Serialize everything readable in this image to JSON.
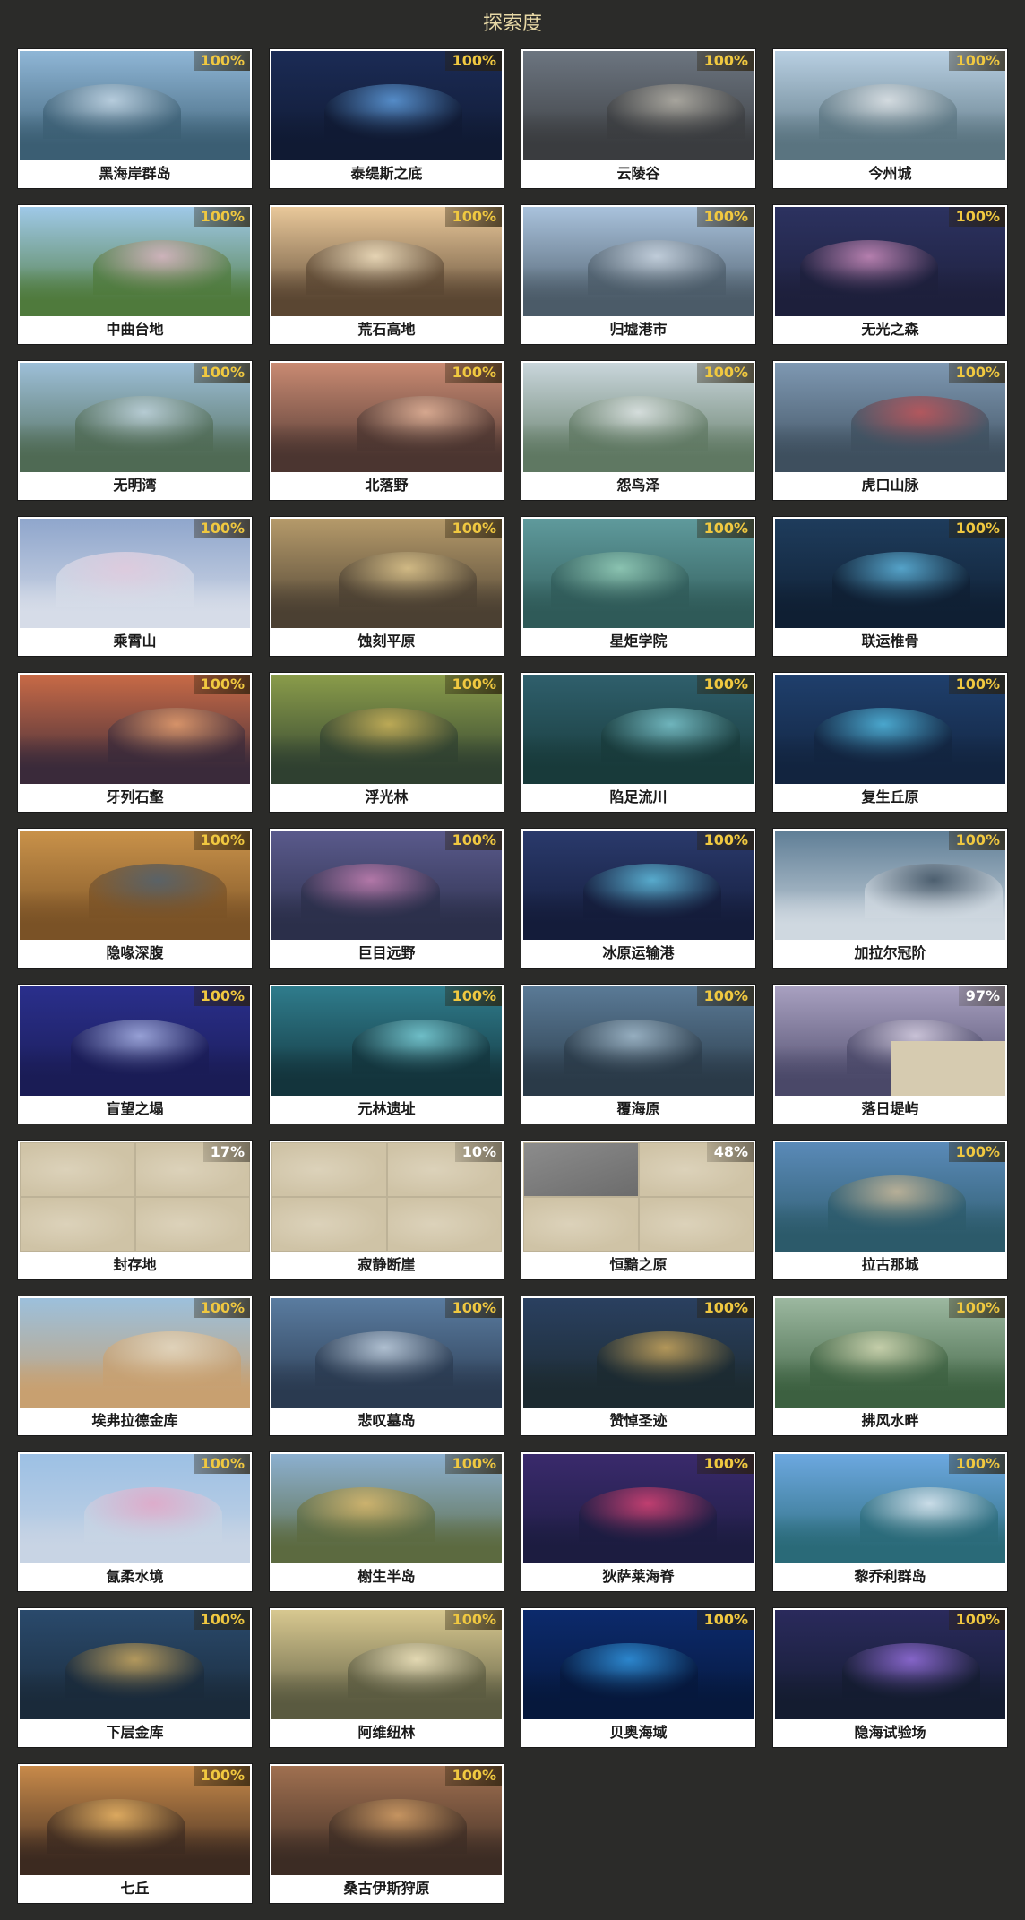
{
  "title": "探索度",
  "regions": [
    {
      "name": "黑海岸群岛",
      "progress": "100%",
      "sky": "#8fb6d6",
      "ground": "#3b5e73",
      "accent": "#d7e6f2"
    },
    {
      "name": "泰缇斯之底",
      "progress": "100%",
      "sky": "#1b2b55",
      "ground": "#101a33",
      "accent": "#6fb8ff"
    },
    {
      "name": "云陵谷",
      "progress": "100%",
      "sky": "#6c7580",
      "ground": "#3a3c3f",
      "accent": "#c9c3b5"
    },
    {
      "name": "今州城",
      "progress": "100%",
      "sky": "#b8cfe2",
      "ground": "#5a7480",
      "accent": "#f1f1f1"
    },
    {
      "name": "中曲台地",
      "progress": "100%",
      "sky": "#9fc9e8",
      "ground": "#4f7a3c",
      "accent": "#f0b8c8"
    },
    {
      "name": "荒石高地",
      "progress": "100%",
      "sky": "#e9c89a",
      "ground": "#5a4632",
      "accent": "#fff1d2"
    },
    {
      "name": "归墟港市",
      "progress": "100%",
      "sky": "#a9c2dc",
      "ground": "#4b5b68",
      "accent": "#dbe4ee"
    },
    {
      "name": "无光之森",
      "progress": "100%",
      "sky": "#2c3260",
      "ground": "#1d1f3b",
      "accent": "#f2a3d6"
    },
    {
      "name": "无明湾",
      "progress": "100%",
      "sky": "#9dbfd8",
      "ground": "#4f6a54",
      "accent": "#cfe0ea"
    },
    {
      "name": "北落野",
      "progress": "100%",
      "sky": "#c98a72",
      "ground": "#4b3530",
      "accent": "#f3c4a8"
    },
    {
      "name": "怨鸟泽",
      "progress": "100%",
      "sky": "#c9d6dc",
      "ground": "#5f7862",
      "accent": "#eef2f3"
    },
    {
      "name": "虎口山脉",
      "progress": "100%",
      "sky": "#7e98b2",
      "ground": "#3e4f5e",
      "accent": "#d44a4a"
    },
    {
      "name": "乘霄山",
      "progress": "100%",
      "sky": "#8fa6cc",
      "ground": "#d6dce8",
      "accent": "#f0d0e0"
    },
    {
      "name": "蚀刻平原",
      "progress": "100%",
      "sky": "#b59a6a",
      "ground": "#4b4032",
      "accent": "#f0d79a"
    },
    {
      "name": "星炬学院",
      "progress": "100%",
      "sky": "#5f9a9c",
      "ground": "#2f5a58",
      "accent": "#a6e0c6"
    },
    {
      "name": "联运椎骨",
      "progress": "100%",
      "sky": "#1e3c5c",
      "ground": "#0f1f33",
      "accent": "#6fd4ff"
    },
    {
      "name": "牙列石壑",
      "progress": "100%",
      "sky": "#c86a46",
      "ground": "#3a2a3a",
      "accent": "#f7b07a"
    },
    {
      "name": "浮光林",
      "progress": "100%",
      "sky": "#8a9c4a",
      "ground": "#2f4030",
      "accent": "#e2c060"
    },
    {
      "name": "陷足流川",
      "progress": "100%",
      "sky": "#2f5f6c",
      "ground": "#183a3a",
      "accent": "#8fe0e8"
    },
    {
      "name": "复生丘原",
      "progress": "100%",
      "sky": "#1f3f6c",
      "ground": "#12243f",
      "accent": "#5fd8ff"
    },
    {
      "name": "隐喙深腹",
      "progress": "100%",
      "sky": "#c9924a",
      "ground": "#7a5226",
      "accent": "#3a5a7a"
    },
    {
      "name": "巨目远野",
      "progress": "100%",
      "sky": "#5a5a8c",
      "ground": "#2b2f4a",
      "accent": "#e08cc0"
    },
    {
      "name": "冰原运输港",
      "progress": "100%",
      "sky": "#2a3a6c",
      "ground": "#141c3a",
      "accent": "#6fe0ff"
    },
    {
      "name": "加拉尔冠阶",
      "progress": "100%",
      "sky": "#5f7e96",
      "ground": "#cfd8e0",
      "accent": "#2f4050"
    },
    {
      "name": "盲望之塌",
      "progress": "100%",
      "sky": "#2a2f8c",
      "ground": "#1a1c55",
      "accent": "#c8d4ff"
    },
    {
      "name": "元林遗址",
      "progress": "100%",
      "sky": "#2f7c8c",
      "ground": "#13343c",
      "accent": "#8fe8f0"
    },
    {
      "name": "覆海原",
      "progress": "100%",
      "sky": "#5a7a96",
      "ground": "#2a3a48",
      "accent": "#b8d0e0"
    },
    {
      "name": "落日堤屿",
      "progress": "97%",
      "sky": "#a8a0c0",
      "ground": "#4a4868",
      "accent": "#e8e0f0",
      "partial": true
    },
    {
      "name": "封存地",
      "progress": "17%",
      "locked": true
    },
    {
      "name": "寂静断崖",
      "progress": "10%",
      "locked": true
    },
    {
      "name": "恒黯之原",
      "progress": "48%",
      "locked": true,
      "partial_tl": true
    },
    {
      "name": "拉古那城",
      "progress": "100%",
      "sky": "#5a8ab8",
      "ground": "#2c5a6a",
      "accent": "#e8c898"
    },
    {
      "name": "埃弗拉德金库",
      "progress": "100%",
      "sky": "#9cc0dc",
      "ground": "#c8a070",
      "accent": "#f4e0c0"
    },
    {
      "name": "悲叹墓岛",
      "progress": "100%",
      "sky": "#5a7ca0",
      "ground": "#2a3a50",
      "accent": "#dce8f4"
    },
    {
      "name": "赞悼圣迹",
      "progress": "100%",
      "sky": "#2a4060",
      "ground": "#1c2a30",
      "accent": "#f0c060"
    },
    {
      "name": "拂风水畔",
      "progress": "100%",
      "sky": "#9cb8a0",
      "ground": "#3c6040",
      "accent": "#e8e8c0"
    },
    {
      "name": "氤柔水境",
      "progress": "100%",
      "sky": "#9cc0e4",
      "ground": "#c8d4e4",
      "accent": "#f0a0c0"
    },
    {
      "name": "榭生半岛",
      "progress": "100%",
      "sky": "#8cb0d0",
      "ground": "#5c6a40",
      "accent": "#f0c060"
    },
    {
      "name": "狄萨莱海脊",
      "progress": "100%",
      "sky": "#3a2a6c",
      "ground": "#1c1c40",
      "accent": "#ff4a7a"
    },
    {
      "name": "黎乔利群岛",
      "progress": "100%",
      "sky": "#6ca8e0",
      "ground": "#2a6a78",
      "accent": "#ffffff"
    },
    {
      "name": "下层金库",
      "progress": "100%",
      "sky": "#2a4a6c",
      "ground": "#1a2a3a",
      "accent": "#f0c060"
    },
    {
      "name": "阿维纽林",
      "progress": "100%",
      "sky": "#d8c890",
      "ground": "#5a5a40",
      "accent": "#fff4d0"
    },
    {
      "name": "贝奥海域",
      "progress": "100%",
      "sky": "#0c2a6c",
      "ground": "#06183c",
      "accent": "#3ab0ff"
    },
    {
      "name": "隐海试验场",
      "progress": "100%",
      "sky": "#2a2a5c",
      "ground": "#141c30",
      "accent": "#b080ff"
    },
    {
      "name": "七丘",
      "progress": "100%",
      "sky": "#c88a4a",
      "ground": "#3c2a20",
      "accent": "#ffc870"
    },
    {
      "name": "桑古伊斯狩原",
      "progress": "100%",
      "sky": "#a07050",
      "ground": "#3c2c24",
      "accent": "#e8b070"
    }
  ]
}
